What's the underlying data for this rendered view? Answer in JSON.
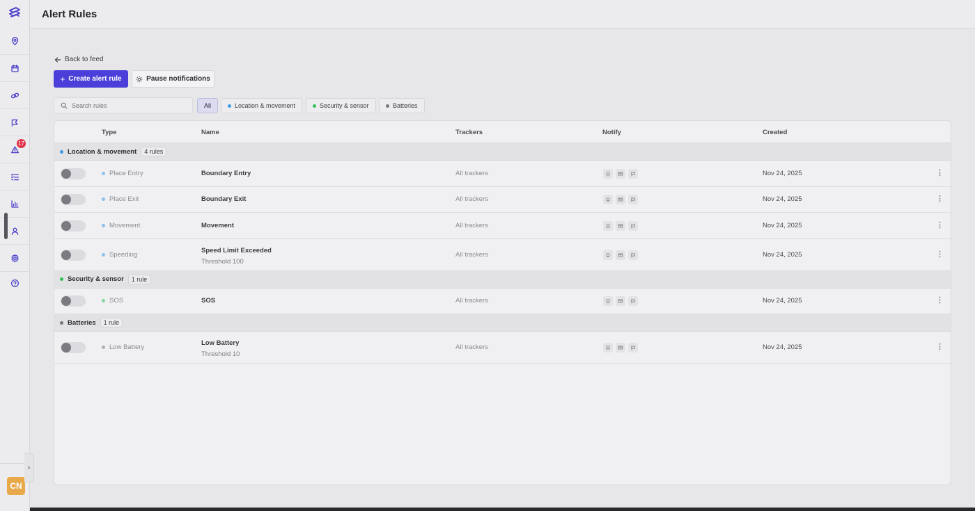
{
  "sidebar": {
    "badge_count": "17",
    "avatar_initials": "CN",
    "icons": [
      "location-pin-icon",
      "calendar-icon",
      "link-icon",
      "route-icon",
      "alert-triangle-icon",
      "checklist-icon",
      "bar-chart-icon",
      "user-icon",
      "gear-icon",
      "help-circle-icon"
    ]
  },
  "header": {
    "title": "Alert Rules"
  },
  "actions": {
    "back_label": "Back to feed",
    "create_label": "Create alert rule",
    "pause_label": "Pause notifications"
  },
  "search": {
    "placeholder": "Search rules"
  },
  "filters": {
    "all": "All",
    "location": "Location & movement",
    "security": "Security & sensor",
    "batteries": "Batteries"
  },
  "colors": {
    "accent": "#4a3fd8",
    "location_dot": "#3b9be6",
    "security_dot": "#2fbf5a",
    "batteries_dot": "#77777e",
    "badge": "#e0344a",
    "avatar": "#e7a94a"
  },
  "table": {
    "columns": {
      "type": "Type",
      "name": "Name",
      "trackers": "Trackers",
      "notify": "Notify",
      "created": "Created"
    },
    "groups": [
      {
        "label": "Location & movement",
        "count": "4 rules",
        "rows": [
          {
            "type": "Place Entry",
            "name": "Boundary Entry",
            "sub": "",
            "trackers": "All trackers",
            "created": "Nov 24, 2025"
          },
          {
            "type": "Place Exit",
            "name": "Boundary Exit",
            "sub": "",
            "trackers": "All trackers",
            "created": "Nov 24, 2025"
          },
          {
            "type": "Movement",
            "name": "Movement",
            "sub": "",
            "trackers": "All trackers",
            "created": "Nov 24, 2025"
          },
          {
            "type": "Speeding",
            "name": "Speed Limit Exceeded",
            "sub": "Threshold 100",
            "trackers": "All trackers",
            "created": "Nov 24, 2025"
          }
        ]
      },
      {
        "label": "Security & sensor",
        "count": "1 rule",
        "rows": [
          {
            "type": "SOS",
            "name": "SOS",
            "sub": "",
            "trackers": "All trackers",
            "created": "Nov 24, 2025"
          }
        ]
      },
      {
        "label": "Batteries",
        "count": "1 rule",
        "rows": [
          {
            "type": "Low Battery",
            "name": "Low Battery",
            "sub": "Threshold 10",
            "trackers": "All trackers",
            "created": "Nov 24, 2025"
          }
        ]
      }
    ]
  }
}
